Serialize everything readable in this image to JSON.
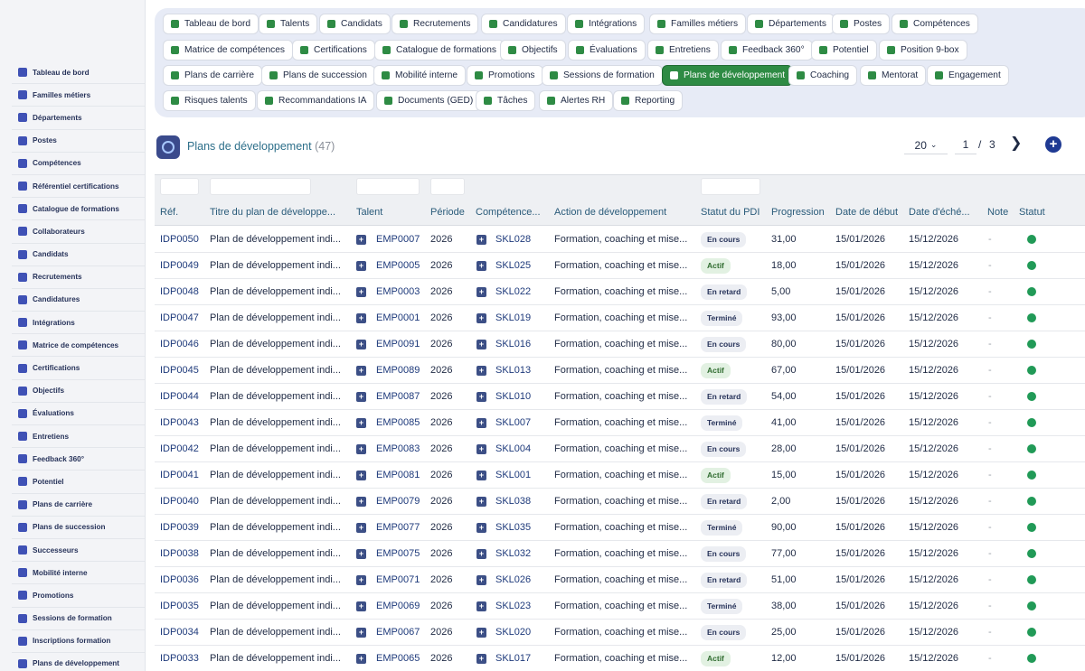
{
  "sidebar": {
    "items": [
      {
        "label": "Tableau de bord",
        "icon": "dashboard-icon"
      },
      {
        "label": "Familles métiers",
        "icon": "sitemap-icon"
      },
      {
        "label": "Départements",
        "icon": "building-icon"
      },
      {
        "label": "Postes",
        "icon": "id-badge-icon"
      },
      {
        "label": "Compétences",
        "icon": "brain-icon"
      },
      {
        "label": "Référentiel certifications",
        "icon": "certificate-icon"
      },
      {
        "label": "Catalogue de formations",
        "icon": "graduation-cap-icon"
      },
      {
        "label": "Collaborateurs",
        "icon": "user-icon"
      },
      {
        "label": "Candidats",
        "icon": "user-plus-icon"
      },
      {
        "label": "Recrutements",
        "icon": "bullhorn-icon"
      },
      {
        "label": "Candidatures",
        "icon": "file-signature-icon"
      },
      {
        "label": "Intégrations",
        "icon": "door-open-icon"
      },
      {
        "label": "Matrice de compétences",
        "icon": "sitemap-icon"
      },
      {
        "label": "Certifications",
        "icon": "award-icon"
      },
      {
        "label": "Objectifs",
        "icon": "target-icon"
      },
      {
        "label": "Évaluations",
        "icon": "star-half-icon"
      },
      {
        "label": "Entretiens",
        "icon": "comments-icon"
      },
      {
        "label": "Feedback 360°",
        "icon": "comment-dots-icon"
      },
      {
        "label": "Potentiel",
        "icon": "chart-line-icon"
      },
      {
        "label": "Plans de carrière",
        "icon": "sitemap-icon"
      },
      {
        "label": "Plans de succession",
        "icon": "sitemap-icon"
      },
      {
        "label": "Successeurs",
        "icon": "users-icon"
      },
      {
        "label": "Mobilité interne",
        "icon": "exchange-icon"
      },
      {
        "label": "Promotions",
        "icon": "arrow-up-icon"
      },
      {
        "label": "Sessions de formation",
        "icon": "chalkboard-icon"
      },
      {
        "label": "Inscriptions formation",
        "icon": "user-check-icon"
      },
      {
        "label": "Plans de développement",
        "icon": "clipboard-icon"
      }
    ]
  },
  "topnav": {
    "chips": [
      {
        "label": "Tableau de bord",
        "icon": "dashboard-icon",
        "active": false
      },
      {
        "label": "Talents",
        "icon": "user-icon",
        "active": false
      },
      {
        "label": "Candidats",
        "icon": "user-plus-icon",
        "active": false
      },
      {
        "label": "Recrutements",
        "icon": "bullhorn-icon",
        "active": false
      },
      {
        "label": "Candidatures",
        "icon": "file-signature-icon",
        "active": false
      },
      {
        "label": "Intégrations",
        "icon": "door-open-icon",
        "active": false
      },
      {
        "label": "Familles métiers",
        "icon": "sitemap-icon",
        "active": false
      },
      {
        "label": "Départements",
        "icon": "building-icon",
        "active": false
      },
      {
        "label": "Postes",
        "icon": "id-badge-icon",
        "active": false
      },
      {
        "label": "Compétences",
        "icon": "brain-icon",
        "active": false
      },
      {
        "label": "Matrice de compétences",
        "icon": "sitemap-icon",
        "active": false
      },
      {
        "label": "Certifications",
        "icon": "award-icon",
        "active": false
      },
      {
        "label": "Catalogue de formations",
        "icon": "graduation-cap-icon",
        "active": false
      },
      {
        "label": "Objectifs",
        "icon": "target-icon",
        "active": false
      },
      {
        "label": "Évaluations",
        "icon": "star-half-icon",
        "active": false
      },
      {
        "label": "Entretiens",
        "icon": "comments-icon",
        "active": false
      },
      {
        "label": "Feedback 360°",
        "icon": "comment-dots-icon",
        "active": false
      },
      {
        "label": "Potentiel",
        "icon": "chart-line-icon",
        "active": false
      },
      {
        "label": "Position 9-box",
        "icon": "grid-icon",
        "active": false
      },
      {
        "label": "Plans de carrière",
        "icon": "sitemap-icon",
        "active": false
      },
      {
        "label": "Plans de succession",
        "icon": "sitemap-icon",
        "active": false
      },
      {
        "label": "Mobilité interne",
        "icon": "exchange-icon",
        "active": false
      },
      {
        "label": "Promotions",
        "icon": "arrow-up-icon",
        "active": false
      },
      {
        "label": "Sessions de formation",
        "icon": "chalkboard-icon",
        "active": false
      },
      {
        "label": "Plans de développement",
        "icon": "clipboard-icon",
        "active": true
      },
      {
        "label": "Coaching",
        "icon": "handshake-icon",
        "active": false
      },
      {
        "label": "Mentorat",
        "icon": "user-tie-icon",
        "active": false
      },
      {
        "label": "Engagement",
        "icon": "heart-icon",
        "active": false
      },
      {
        "label": "Risques talents",
        "icon": "warning-icon",
        "active": false
      },
      {
        "label": "Recommandations IA",
        "icon": "robot-icon",
        "active": false
      },
      {
        "label": "Documents (GED)",
        "icon": "folder-icon",
        "active": false
      },
      {
        "label": "Tâches",
        "icon": "list-icon",
        "active": false
      },
      {
        "label": "Alertes RH",
        "icon": "bell-icon",
        "active": false
      },
      {
        "label": "Reporting",
        "icon": "pie-chart-icon",
        "active": false
      }
    ]
  },
  "header": {
    "title": "Plans de développement",
    "count": "(47)",
    "page_size": "20",
    "current_page": "1",
    "page_sep": "/",
    "total_pages": "3",
    "next_icon": "chevron-right-icon",
    "add_icon": "plus-circle-icon"
  },
  "table": {
    "columns": [
      "Réf.",
      "Titre du plan de développe...",
      "Talent",
      "Période",
      "Compétence...",
      "Action de développement",
      "Statut du PDI",
      "Progression",
      "Date de début",
      "Date d'éché...",
      "Note",
      "Statut"
    ],
    "rows": [
      {
        "ref": "IDP0050",
        "title": "Plan de développement indi...",
        "talent": "EMP0007",
        "period": "2026",
        "skill": "SKL028",
        "action": "Formation, coaching et mise...",
        "status": "En cours",
        "progress": "31,00",
        "start": "15/01/2026",
        "due": "15/12/2026",
        "note": "-"
      },
      {
        "ref": "IDP0049",
        "title": "Plan de développement indi...",
        "talent": "EMP0005",
        "period": "2026",
        "skill": "SKL025",
        "action": "Formation, coaching et mise...",
        "status": "Actif",
        "progress": "18,00",
        "start": "15/01/2026",
        "due": "15/12/2026",
        "note": "-"
      },
      {
        "ref": "IDP0048",
        "title": "Plan de développement indi...",
        "talent": "EMP0003",
        "period": "2026",
        "skill": "SKL022",
        "action": "Formation, coaching et mise...",
        "status": "En retard",
        "progress": "5,00",
        "start": "15/01/2026",
        "due": "15/12/2026",
        "note": "-"
      },
      {
        "ref": "IDP0047",
        "title": "Plan de développement indi...",
        "talent": "EMP0001",
        "period": "2026",
        "skill": "SKL019",
        "action": "Formation, coaching et mise...",
        "status": "Terminé",
        "progress": "93,00",
        "start": "15/01/2026",
        "due": "15/12/2026",
        "note": "-"
      },
      {
        "ref": "IDP0046",
        "title": "Plan de développement indi...",
        "talent": "EMP0091",
        "period": "2026",
        "skill": "SKL016",
        "action": "Formation, coaching et mise...",
        "status": "En cours",
        "progress": "80,00",
        "start": "15/01/2026",
        "due": "15/12/2026",
        "note": "-"
      },
      {
        "ref": "IDP0045",
        "title": "Plan de développement indi...",
        "talent": "EMP0089",
        "period": "2026",
        "skill": "SKL013",
        "action": "Formation, coaching et mise...",
        "status": "Actif",
        "progress": "67,00",
        "start": "15/01/2026",
        "due": "15/12/2026",
        "note": "-"
      },
      {
        "ref": "IDP0044",
        "title": "Plan de développement indi...",
        "talent": "EMP0087",
        "period": "2026",
        "skill": "SKL010",
        "action": "Formation, coaching et mise...",
        "status": "En retard",
        "progress": "54,00",
        "start": "15/01/2026",
        "due": "15/12/2026",
        "note": "-"
      },
      {
        "ref": "IDP0043",
        "title": "Plan de développement indi...",
        "talent": "EMP0085",
        "period": "2026",
        "skill": "SKL007",
        "action": "Formation, coaching et mise...",
        "status": "Terminé",
        "progress": "41,00",
        "start": "15/01/2026",
        "due": "15/12/2026",
        "note": "-"
      },
      {
        "ref": "IDP0042",
        "title": "Plan de développement indi...",
        "talent": "EMP0083",
        "period": "2026",
        "skill": "SKL004",
        "action": "Formation, coaching et mise...",
        "status": "En cours",
        "progress": "28,00",
        "start": "15/01/2026",
        "due": "15/12/2026",
        "note": "-"
      },
      {
        "ref": "IDP0041",
        "title": "Plan de développement indi...",
        "talent": "EMP0081",
        "period": "2026",
        "skill": "SKL001",
        "action": "Formation, coaching et mise...",
        "status": "Actif",
        "progress": "15,00",
        "start": "15/01/2026",
        "due": "15/12/2026",
        "note": "-"
      },
      {
        "ref": "IDP0040",
        "title": "Plan de développement indi...",
        "talent": "EMP0079",
        "period": "2026",
        "skill": "SKL038",
        "action": "Formation, coaching et mise...",
        "status": "En retard",
        "progress": "2,00",
        "start": "15/01/2026",
        "due": "15/12/2026",
        "note": "-"
      },
      {
        "ref": "IDP0039",
        "title": "Plan de développement indi...",
        "talent": "EMP0077",
        "period": "2026",
        "skill": "SKL035",
        "action": "Formation, coaching et mise...",
        "status": "Terminé",
        "progress": "90,00",
        "start": "15/01/2026",
        "due": "15/12/2026",
        "note": "-"
      },
      {
        "ref": "IDP0038",
        "title": "Plan de développement indi...",
        "talent": "EMP0075",
        "period": "2026",
        "skill": "SKL032",
        "action": "Formation, coaching et mise...",
        "status": "En cours",
        "progress": "77,00",
        "start": "15/01/2026",
        "due": "15/12/2026",
        "note": "-"
      },
      {
        "ref": "IDP0036",
        "title": "Plan de développement indi...",
        "talent": "EMP0071",
        "period": "2026",
        "skill": "SKL026",
        "action": "Formation, coaching et mise...",
        "status": "En retard",
        "progress": "51,00",
        "start": "15/01/2026",
        "due": "15/12/2026",
        "note": "-"
      },
      {
        "ref": "IDP0035",
        "title": "Plan de développement indi...",
        "talent": "EMP0069",
        "period": "2026",
        "skill": "SKL023",
        "action": "Formation, coaching et mise...",
        "status": "Terminé",
        "progress": "38,00",
        "start": "15/01/2026",
        "due": "15/12/2026",
        "note": "-"
      },
      {
        "ref": "IDP0034",
        "title": "Plan de développement indi...",
        "talent": "EMP0067",
        "period": "2026",
        "skill": "SKL020",
        "action": "Formation, coaching et mise...",
        "status": "En cours",
        "progress": "25,00",
        "start": "15/01/2026",
        "due": "15/12/2026",
        "note": "-"
      },
      {
        "ref": "IDP0033",
        "title": "Plan de développement indi...",
        "talent": "EMP0065",
        "period": "2026",
        "skill": "SKL017",
        "action": "Formation, coaching et mise...",
        "status": "Actif",
        "progress": "12,00",
        "start": "15/01/2026",
        "due": "15/12/2026",
        "note": "-"
      }
    ]
  },
  "colors": {
    "accent_green": "#2e8b44",
    "status_dot": "#219a57",
    "link_blue": "#1e3a7b",
    "header_teal": "#2d6f8a"
  }
}
